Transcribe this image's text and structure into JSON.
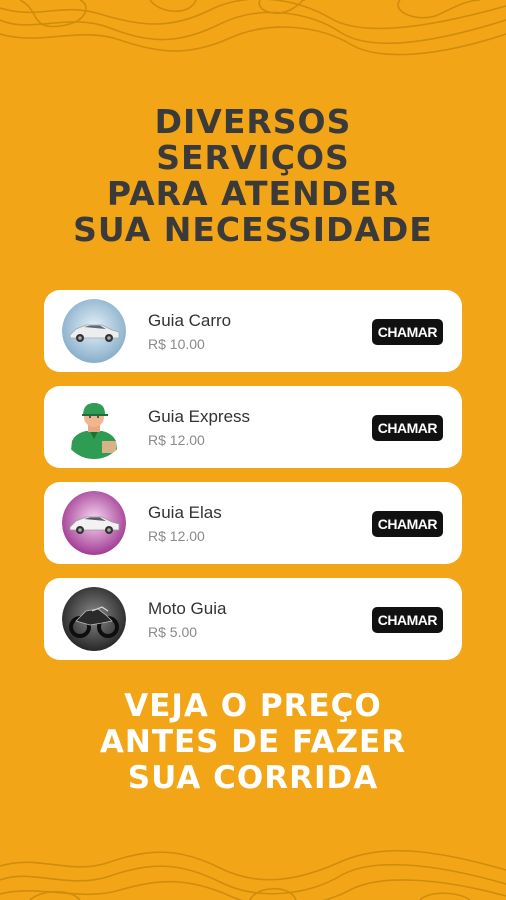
{
  "headline": [
    "DIVERSOS",
    "SERVIÇOS",
    "PARA ATENDER",
    "SUA NECESSIDADE"
  ],
  "services": [
    {
      "name": "Guia Carro",
      "price": "R$ 10.00",
      "button": "CHAMAR",
      "icon": "car-icon"
    },
    {
      "name": "Guia Express",
      "price": "R$ 12.00",
      "button": "CHAMAR",
      "icon": "delivery-person-icon"
    },
    {
      "name": "Guia Elas",
      "price": "R$ 12.00",
      "button": "CHAMAR",
      "icon": "car-pink-icon"
    },
    {
      "name": "Moto Guia",
      "price": "R$ 5.00",
      "button": "CHAMAR",
      "icon": "motorcycle-icon"
    }
  ],
  "footline": [
    "VEJA O PREÇO",
    "ANTES DE FAZER",
    "SUA CORRIDA"
  ],
  "colors": {
    "background": "#F2A516",
    "headline": "#3A3A3A",
    "footline": "#FFFFFF",
    "button": "#111111"
  }
}
